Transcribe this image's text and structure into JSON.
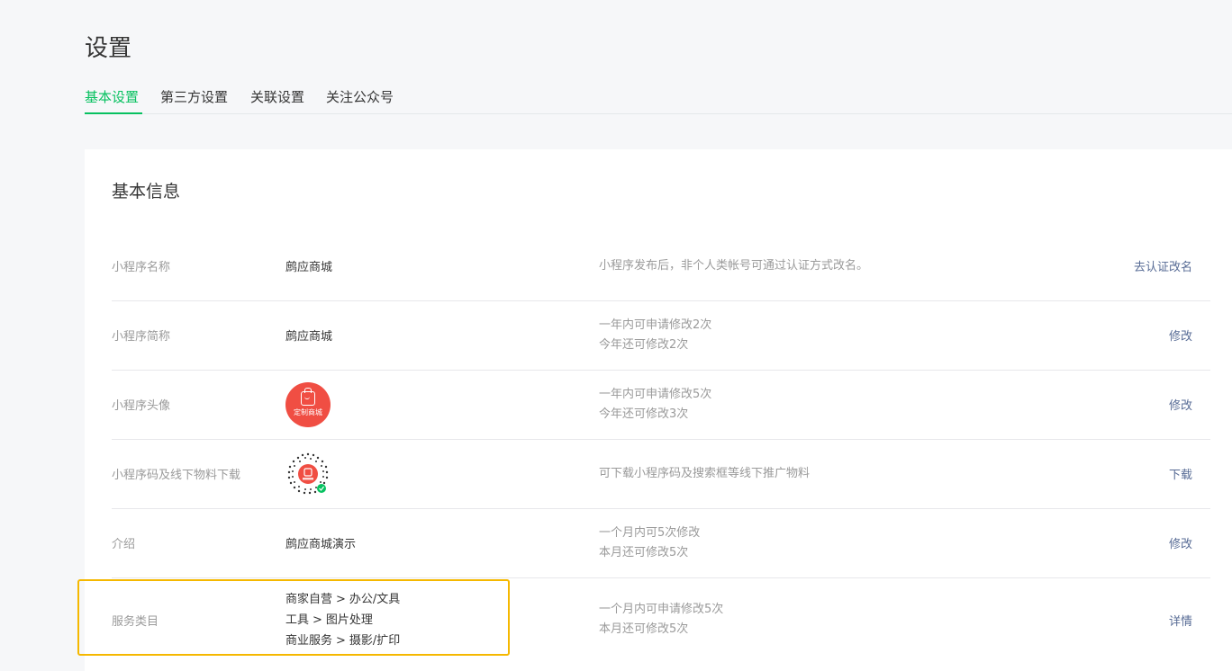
{
  "page": {
    "title": "设置"
  },
  "tabs": [
    {
      "label": "基本设置",
      "active": true
    },
    {
      "label": "第三方设置",
      "active": false
    },
    {
      "label": "关联设置",
      "active": false
    },
    {
      "label": "关注公众号",
      "active": false
    }
  ],
  "colors": {
    "accent": "#07c160",
    "link": "#576b95",
    "highlight": "#f5b800",
    "avatar_bg": "#f04e43"
  },
  "basic_info": {
    "title": "基本信息",
    "rows": [
      {
        "label": "小程序名称",
        "value": "鹧应商城",
        "desc": [
          "小程序发布后，非个人类帐号可通过认证方式改名。"
        ],
        "action": "去认证改名"
      },
      {
        "label": "小程序简称",
        "value": "鹧应商城",
        "desc": [
          "一年内可申请修改2次",
          "今年还可修改2次"
        ],
        "action": "修改"
      },
      {
        "label": "小程序头像",
        "avatar_text": "定制商城",
        "avatar_icon": "shopping-bag-icon",
        "desc": [
          "一年内可申请修改5次",
          "今年还可修改3次"
        ],
        "action": "修改"
      },
      {
        "label": "小程序码及线下物料下载",
        "qr_icon": "mini-program-code-icon",
        "desc": [
          "可下载小程序码及搜索框等线下推广物料"
        ],
        "action": "下载"
      },
      {
        "label": "介绍",
        "value": "鹧应商城演示",
        "desc": [
          "一个月内可5次修改",
          "本月还可修改5次"
        ],
        "action": "修改"
      },
      {
        "label": "服务类目",
        "categories": [
          [
            "商家自营",
            "办公/文具"
          ],
          [
            "工具",
            "图片处理"
          ],
          [
            "商业服务",
            "摄影/扩印"
          ]
        ],
        "separator": ">",
        "desc": [
          "一个月内可申请修改5次",
          "本月还可修改5次"
        ],
        "action": "详情"
      }
    ]
  }
}
